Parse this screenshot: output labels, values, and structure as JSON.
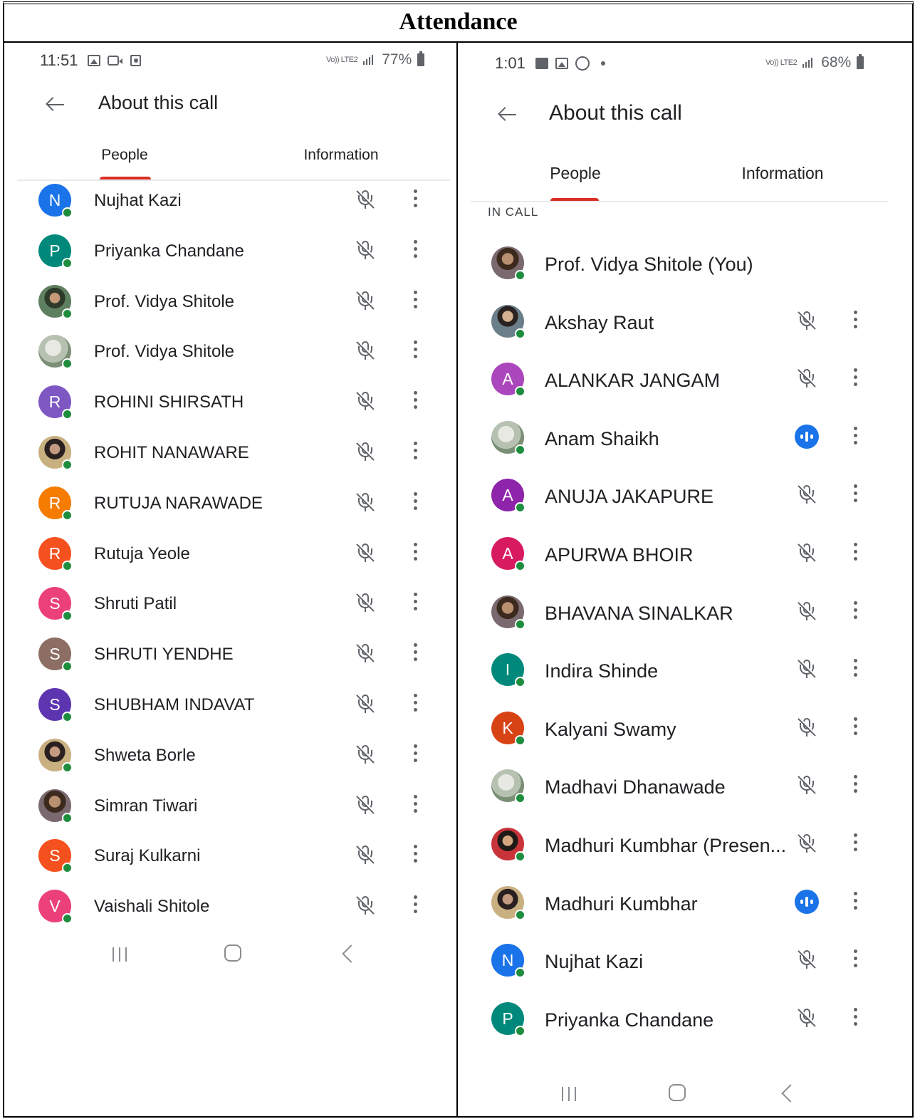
{
  "document": {
    "title": "Attendance"
  },
  "left": {
    "status": {
      "time": "11:51",
      "network": "Vo)) LTE2",
      "battery": "77%"
    },
    "header": {
      "title": "About this call"
    },
    "tabs": [
      {
        "label": "People",
        "active": true
      },
      {
        "label": "Information",
        "active": false
      }
    ],
    "participants": [
      {
        "name": "Nujhat Kazi",
        "initial": "N",
        "color": "#1a73e8",
        "photo": false
      },
      {
        "name": "Priyanka Chandane",
        "initial": "P",
        "color": "#00897b",
        "photo": false
      },
      {
        "name": "Prof. Vidya Shitole",
        "initial": "",
        "color": "",
        "photo": true
      },
      {
        "name": "Prof. Vidya Shitole",
        "initial": "",
        "color": "",
        "photo": true
      },
      {
        "name": "ROHINI SHIRSATH",
        "initial": "R",
        "color": "#7e57c2",
        "photo": false
      },
      {
        "name": "ROHIT NANAWARE",
        "initial": "",
        "color": "",
        "photo": true
      },
      {
        "name": "RUTUJA NARAWADE",
        "initial": "R",
        "color": "#f57c00",
        "photo": false
      },
      {
        "name": "Rutuja Yeole",
        "initial": "R",
        "color": "#f4511e",
        "photo": false
      },
      {
        "name": "Shruti Patil",
        "initial": "S",
        "color": "#ec407a",
        "photo": false
      },
      {
        "name": "SHRUTI YENDHE",
        "initial": "S",
        "color": "#8d6e63",
        "photo": false
      },
      {
        "name": "SHUBHAM INDAVAT",
        "initial": "S",
        "color": "#5e35b1",
        "photo": false
      },
      {
        "name": "Shweta Borle",
        "initial": "",
        "color": "",
        "photo": true
      },
      {
        "name": "Simran Tiwari",
        "initial": "",
        "color": "",
        "photo": true
      },
      {
        "name": "Suraj Kulkarni",
        "initial": "S",
        "color": "#f4511e",
        "photo": false
      },
      {
        "name": "Vaishali Shitole",
        "initial": "V",
        "color": "#ec407a",
        "photo": false
      }
    ]
  },
  "right": {
    "status": {
      "time": "1:01",
      "network": "Vo)) LTE2",
      "battery": "68%"
    },
    "header": {
      "title": "About this call"
    },
    "tabs": [
      {
        "label": "People",
        "active": true
      },
      {
        "label": "Information",
        "active": false
      }
    ],
    "section_label": "IN CALL",
    "participants": [
      {
        "name": "Prof. Vidya Shitole (You)",
        "initial": "",
        "color": "",
        "photo": true,
        "mic": "none"
      },
      {
        "name": "Akshay Raut",
        "initial": "",
        "color": "",
        "photo": true,
        "mic": "muted"
      },
      {
        "name": "ALANKAR JANGAM",
        "initial": "A",
        "color": "#ab47bc",
        "photo": false,
        "mic": "muted"
      },
      {
        "name": "Anam Shaikh",
        "initial": "",
        "color": "",
        "photo": true,
        "mic": "speaking"
      },
      {
        "name": "ANUJA JAKAPURE",
        "initial": "A",
        "color": "#8e24aa",
        "photo": false,
        "mic": "muted"
      },
      {
        "name": "APURWA BHOIR",
        "initial": "A",
        "color": "#d81b60",
        "photo": false,
        "mic": "muted"
      },
      {
        "name": "BHAVANA SINALKAR",
        "initial": "",
        "color": "",
        "photo": true,
        "mic": "muted"
      },
      {
        "name": "Indira Shinde",
        "initial": "I",
        "color": "#00897b",
        "photo": false,
        "mic": "muted"
      },
      {
        "name": "Kalyani Swamy",
        "initial": "K",
        "color": "#d84315",
        "photo": false,
        "mic": "muted"
      },
      {
        "name": "Madhavi Dhanawade",
        "initial": "",
        "color": "",
        "photo": true,
        "mic": "muted"
      },
      {
        "name": "Madhuri Kumbhar (Presen...",
        "initial": "",
        "color": "",
        "photo": true,
        "mic": "muted"
      },
      {
        "name": "Madhuri Kumbhar",
        "initial": "",
        "color": "",
        "photo": true,
        "mic": "speaking"
      },
      {
        "name": "Nujhat Kazi",
        "initial": "N",
        "color": "#1a73e8",
        "photo": false,
        "mic": "muted"
      },
      {
        "name": "Priyanka Chandane",
        "initial": "P",
        "color": "#00897b",
        "photo": false,
        "mic": "muted"
      }
    ]
  }
}
